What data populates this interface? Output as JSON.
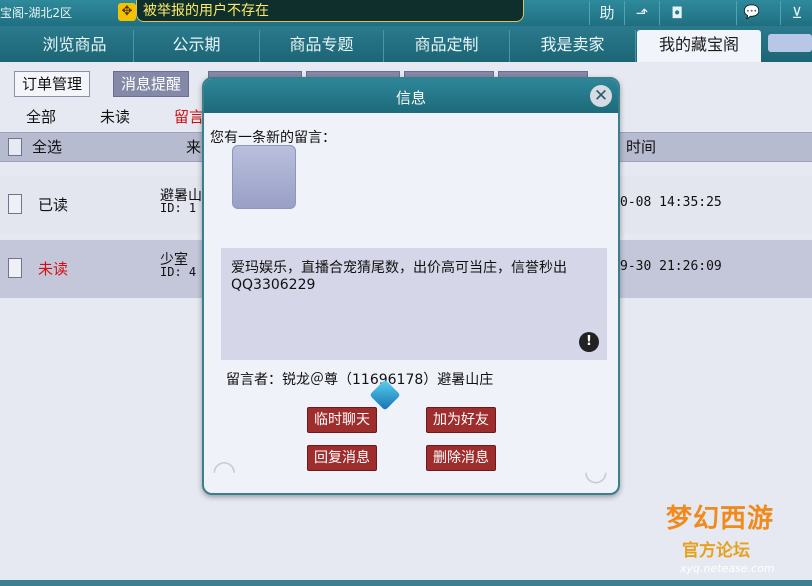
{
  "titlebar": {
    "title": "宝阁-湖北2区",
    "notice": "被举报的用户不存在",
    "buttons": [
      {
        "label": "助",
        "icon": "help-icon"
      },
      {
        "label": "⬏",
        "icon": "share-icon"
      },
      {
        "label": "◘",
        "icon": "record-icon"
      },
      {
        "label": "💬",
        "icon": "chat-icon"
      },
      {
        "label": "⊻",
        "icon": "more-icon"
      }
    ]
  },
  "nav": {
    "tabs": [
      "浏览商品",
      "公示期",
      "商品专题",
      "商品定制",
      "我是卖家",
      "我的藏宝阁"
    ],
    "active_index": 5
  },
  "subtabs": {
    "items": [
      "订单管理",
      "消息提醒"
    ],
    "active_index": 1
  },
  "filters": [
    "全部",
    "未读",
    "留言"
  ],
  "columns": {
    "select_all": "全选",
    "from": "来",
    "time": "时间"
  },
  "rows": [
    {
      "status": "已读",
      "status_color": "#111111",
      "from_line1": "避暑山",
      "from_line2": "ID: 1",
      "time": "0-08 14:35:25"
    },
    {
      "status": "未读",
      "status_color": "#d01010",
      "from_line1": "少室",
      "from_line2": "ID: 4",
      "time": "9-30 21:26:09"
    }
  ],
  "dialog": {
    "title": "信息",
    "intro": "您有一条新的留言：",
    "message": "爱玛娱乐，直播合宠猜尾数，出价高可当庄，信誉秒出QQ3306229",
    "sender": "留言者：锐龙＠尊（11696178）避暑山庄",
    "buttons": {
      "chat": "临时聊天",
      "add_friend": "加为好友",
      "reply": "回复消息",
      "delete": "删除消息"
    }
  },
  "logo": {
    "line1": "梦幻西游",
    "line2": "官方论坛",
    "line3": "xyq.netease.com"
  },
  "colors": {
    "header_teal": "#1f6f80",
    "button_red": "#9e2e2e",
    "notice_text": "#ffea66",
    "unread_red": "#d01010"
  }
}
